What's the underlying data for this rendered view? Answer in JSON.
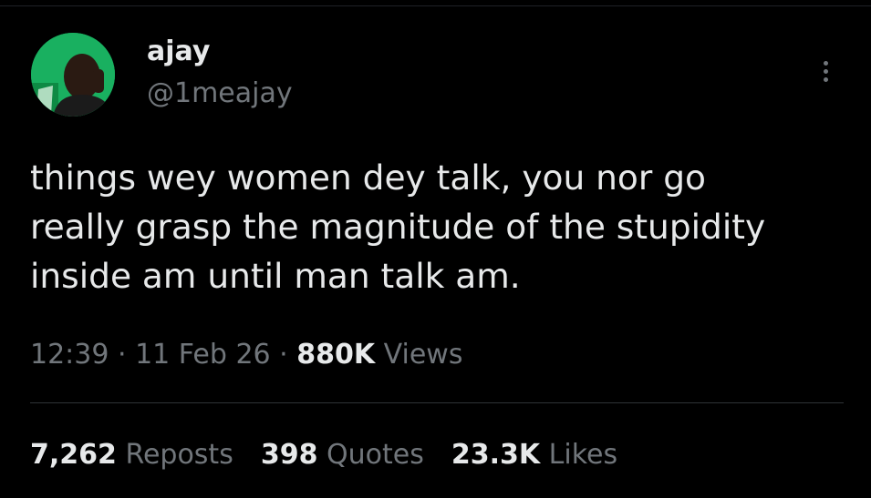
{
  "user": {
    "display_name": "ajay",
    "handle": "@1meajay"
  },
  "tweet": {
    "lines": [
      "things wey women dey talk, you nor go",
      "really grasp the magnitude of the stupidity",
      "inside am until man talk am."
    ]
  },
  "meta": {
    "time": "12:39",
    "separator": " · ",
    "date": "11 Feb 26",
    "views_count": "880K",
    "views_label": "Views"
  },
  "stats": {
    "reposts_count": "7,262",
    "reposts_label": "Reposts",
    "quotes_count": "398",
    "quotes_label": "Quotes",
    "likes_count": "23.3K",
    "likes_label": "Likes"
  },
  "icons": {
    "more": "more-vertical-icon"
  },
  "colors": {
    "background": "#000000",
    "text": "#e7e9ea",
    "secondary_text": "#71767b",
    "divider": "#2f3336",
    "avatar_bg": "#17a85a"
  }
}
